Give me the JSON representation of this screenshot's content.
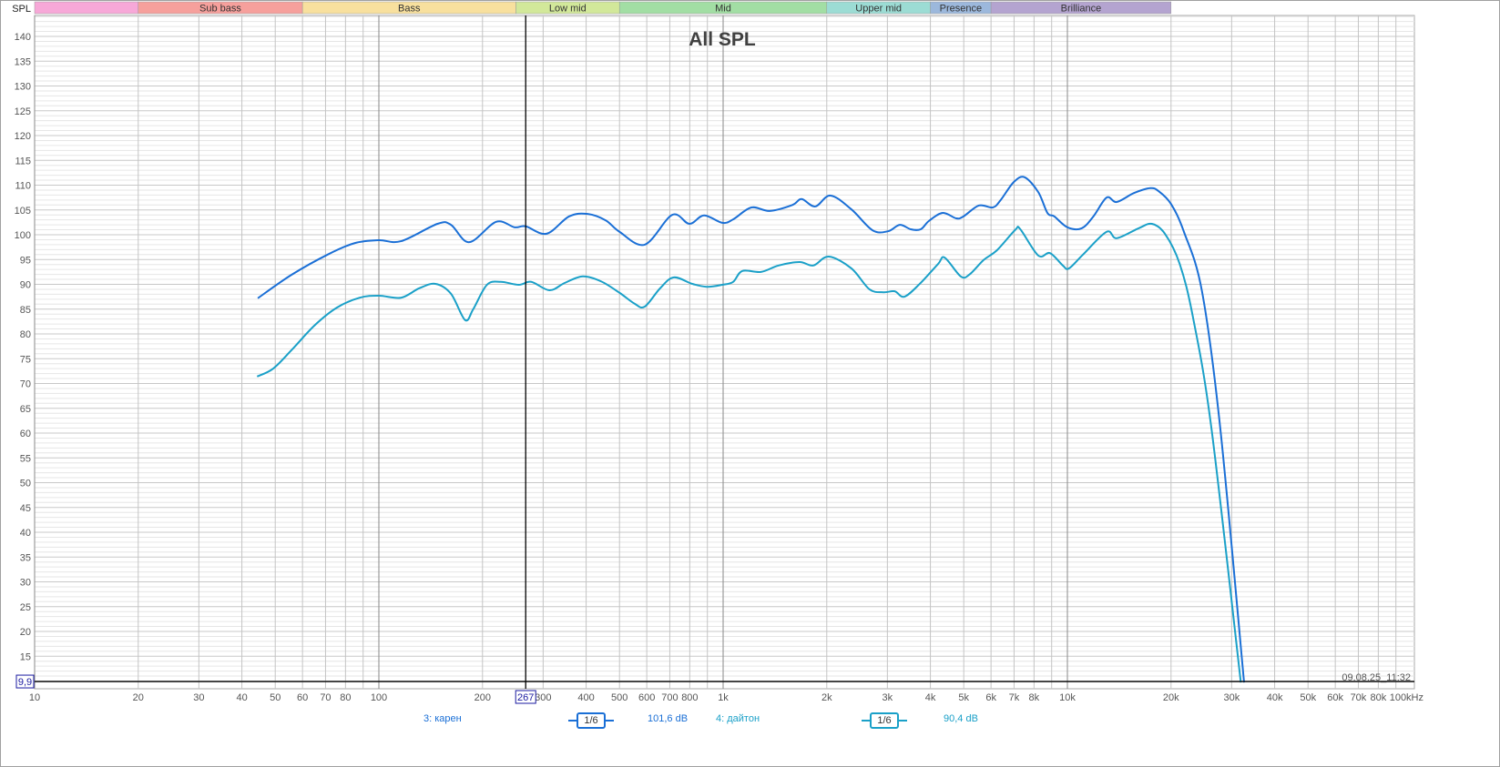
{
  "chart_data": {
    "type": "line",
    "title": "All SPL",
    "ylabel": "SPL",
    "x_unit": "kHz",
    "x_scale": "log",
    "xlim": [
      10,
      100000
    ],
    "ylim": [
      9.9,
      144
    ],
    "grid": true,
    "y_ticks": [
      15,
      20,
      25,
      30,
      35,
      40,
      45,
      50,
      55,
      60,
      65,
      70,
      75,
      80,
      85,
      90,
      95,
      100,
      105,
      110,
      115,
      120,
      125,
      130,
      135,
      140
    ],
    "x_ticks": [
      {
        "f": 10,
        "label": "10"
      },
      {
        "f": 20,
        "label": "20"
      },
      {
        "f": 30,
        "label": "30"
      },
      {
        "f": 40,
        "label": "40"
      },
      {
        "f": 50,
        "label": "50"
      },
      {
        "f": 60,
        "label": "60"
      },
      {
        "f": 70,
        "label": "70"
      },
      {
        "f": 80,
        "label": "80"
      },
      {
        "f": 100,
        "label": "100"
      },
      {
        "f": 200,
        "label": "200"
      },
      {
        "f": 300,
        "label": "300"
      },
      {
        "f": 400,
        "label": "400"
      },
      {
        "f": 500,
        "label": "500"
      },
      {
        "f": 600,
        "label": "600"
      },
      {
        "f": 700,
        "label": "700"
      },
      {
        "f": 800,
        "label": "800"
      },
      {
        "f": 1000,
        "label": "1k"
      },
      {
        "f": 2000,
        "label": "2k"
      },
      {
        "f": 3000,
        "label": "3k"
      },
      {
        "f": 4000,
        "label": "4k"
      },
      {
        "f": 5000,
        "label": "5k"
      },
      {
        "f": 6000,
        "label": "6k"
      },
      {
        "f": 7000,
        "label": "7k"
      },
      {
        "f": 8000,
        "label": "8k"
      },
      {
        "f": 10000,
        "label": "10k"
      },
      {
        "f": 20000,
        "label": "20k"
      },
      {
        "f": 30000,
        "label": "30k"
      },
      {
        "f": 40000,
        "label": "40k"
      },
      {
        "f": 50000,
        "label": "50k"
      },
      {
        "f": 60000,
        "label": "60k"
      },
      {
        "f": 70000,
        "label": "70k"
      },
      {
        "f": 80000,
        "label": "80k"
      },
      {
        "f": 100000,
        "label": "100kHz"
      }
    ],
    "bands": [
      {
        "label": "",
        "from": 10,
        "to": 20,
        "color": "#f7a8d8"
      },
      {
        "label": "Sub bass",
        "from": 20,
        "to": 60,
        "color": "#f6a09c"
      },
      {
        "label": "Bass",
        "from": 60,
        "to": 250,
        "color": "#f8e09e"
      },
      {
        "label": "Low mid",
        "from": 250,
        "to": 500,
        "color": "#d2e89a"
      },
      {
        "label": "Mid",
        "from": 500,
        "to": 2000,
        "color": "#a2dea4"
      },
      {
        "label": "Upper mid",
        "from": 2000,
        "to": 4000,
        "color": "#9cdcd4"
      },
      {
        "label": "Presence",
        "from": 4000,
        "to": 6000,
        "color": "#9cb8dc"
      },
      {
        "label": "Brilliance",
        "from": 6000,
        "to": 20000,
        "color": "#b4a4d0"
      }
    ],
    "cursor": {
      "x": 267,
      "x_label": "267",
      "y": 9.9,
      "y_label": "9,9"
    },
    "timestamp": "09.08.25_11:32",
    "series": [
      {
        "name": "3: карен",
        "color": "#1a6fd6",
        "smoothing": "1/6",
        "level": "101,6 dB",
        "points": [
          [
            44.5,
            87.2
          ],
          [
            55.7,
            91.9
          ],
          [
            71,
            96
          ],
          [
            85,
            98.3
          ],
          [
            100,
            98.9
          ],
          [
            116,
            98.7
          ],
          [
            148,
            102.2
          ],
          [
            162,
            102
          ],
          [
            183,
            98.5
          ],
          [
            219,
            102.6
          ],
          [
            248,
            101.5
          ],
          [
            267,
            101.7
          ],
          [
            307,
            100.2
          ],
          [
            357,
            103.7
          ],
          [
            404,
            104.2
          ],
          [
            456,
            102.9
          ],
          [
            500,
            100.6
          ],
          [
            592,
            98
          ],
          [
            711,
            104
          ],
          [
            798,
            102.2
          ],
          [
            880,
            103.9
          ],
          [
            994,
            102.4
          ],
          [
            1069,
            103.1
          ],
          [
            1208,
            105.5
          ],
          [
            1364,
            104.8
          ],
          [
            1589,
            106
          ],
          [
            1690,
            107.2
          ],
          [
            1851,
            105.7
          ],
          [
            2051,
            107.9
          ],
          [
            2360,
            105.1
          ],
          [
            2716,
            100.9
          ],
          [
            3013,
            100.7
          ],
          [
            3260,
            102
          ],
          [
            3508,
            101.1
          ],
          [
            3750,
            101.1
          ],
          [
            3963,
            102.8
          ],
          [
            4345,
            104.4
          ],
          [
            4755,
            103.3
          ],
          [
            4990,
            103.7
          ],
          [
            5536,
            105.9
          ],
          [
            6070,
            105.5
          ],
          [
            6400,
            107
          ],
          [
            6980,
            110.6
          ],
          [
            7510,
            111.6
          ],
          [
            8230,
            108.6
          ],
          [
            8750,
            104.4
          ],
          [
            9160,
            103.7
          ],
          [
            10000,
            101.5
          ],
          [
            11000,
            101.3
          ],
          [
            11900,
            103.7
          ],
          [
            13000,
            107.5
          ],
          [
            13900,
            106.6
          ],
          [
            15600,
            108.4
          ],
          [
            17400,
            109.4
          ],
          [
            18400,
            108.8
          ],
          [
            20000,
            106.2
          ],
          [
            21800,
            100.6
          ],
          [
            24600,
            88.6
          ],
          [
            27800,
            61
          ],
          [
            32600,
            9.7
          ]
        ]
      },
      {
        "name": "4: дайтон",
        "color": "#1aa0c8",
        "smoothing": "1/6",
        "level": "90,4 dB",
        "points": [
          [
            44.3,
            71.4
          ],
          [
            49.3,
            73
          ],
          [
            55.7,
            76.7
          ],
          [
            65,
            81.7
          ],
          [
            75.5,
            85.3
          ],
          [
            88,
            87.3
          ],
          [
            100,
            87.7
          ],
          [
            116,
            87.3
          ],
          [
            131,
            89.2
          ],
          [
            146,
            90.1
          ],
          [
            162,
            88.1
          ],
          [
            178,
            82.8
          ],
          [
            188,
            85
          ],
          [
            206,
            89.9
          ],
          [
            226,
            90.5
          ],
          [
            255,
            89.9
          ],
          [
            277,
            90.5
          ],
          [
            313,
            88.8
          ],
          [
            347,
            90.3
          ],
          [
            391,
            91.6
          ],
          [
            442,
            90.6
          ],
          [
            500,
            88.3
          ],
          [
            553,
            86.1
          ],
          [
            592,
            85.5
          ],
          [
            656,
            89.2
          ],
          [
            719,
            91.4
          ],
          [
            813,
            90.1
          ],
          [
            896,
            89.5
          ],
          [
            994,
            89.9
          ],
          [
            1069,
            90.5
          ],
          [
            1137,
            92.7
          ],
          [
            1288,
            92.5
          ],
          [
            1449,
            93.8
          ],
          [
            1667,
            94.5
          ],
          [
            1828,
            93.8
          ],
          [
            2028,
            95.6
          ],
          [
            2360,
            93.2
          ],
          [
            2660,
            89
          ],
          [
            2922,
            88.4
          ],
          [
            3150,
            88.6
          ],
          [
            3360,
            87.5
          ],
          [
            3725,
            90.1
          ],
          [
            4210,
            94.1
          ],
          [
            4400,
            95.4
          ],
          [
            4900,
            91.6
          ],
          [
            5200,
            92
          ],
          [
            5710,
            94.9
          ],
          [
            6250,
            96.9
          ],
          [
            7060,
            101
          ],
          [
            7300,
            101.1
          ],
          [
            8230,
            95.8
          ],
          [
            8900,
            96.3
          ],
          [
            9700,
            93.8
          ],
          [
            10100,
            93.2
          ],
          [
            11100,
            96
          ],
          [
            13000,
            100.6
          ],
          [
            13900,
            99.3
          ],
          [
            16100,
            101.3
          ],
          [
            17600,
            102.2
          ],
          [
            19200,
            100.2
          ],
          [
            21200,
            94.1
          ],
          [
            23200,
            83.1
          ],
          [
            26200,
            61
          ],
          [
            31900,
            9.7
          ]
        ]
      }
    ]
  }
}
